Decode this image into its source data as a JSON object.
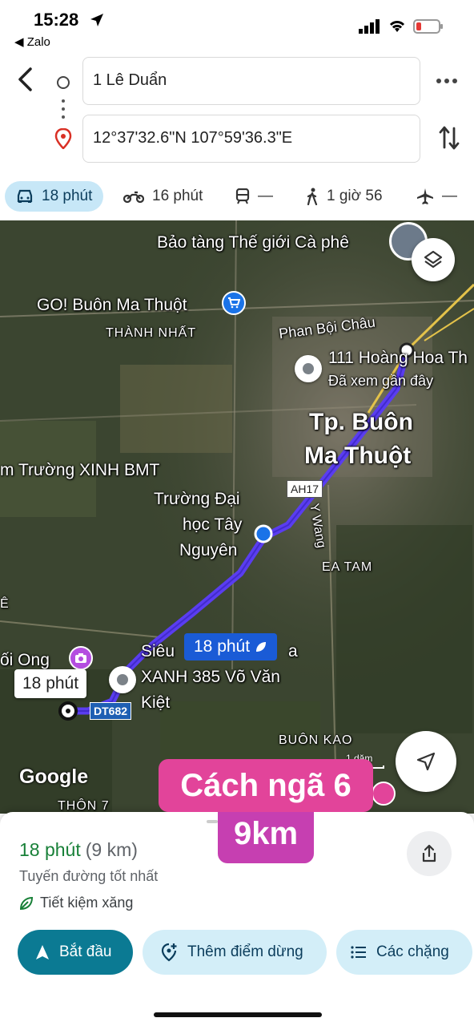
{
  "status_bar": {
    "time": "15:28",
    "back_app": "◀ Zalo"
  },
  "route": {
    "from": "1 Lê Duẩn",
    "to": "12°37'32.6\"N 107°59'36.3\"E"
  },
  "travel_modes": [
    {
      "name": "car",
      "label": "18 phút",
      "active": true
    },
    {
      "name": "motorbike",
      "label": "16 phút"
    },
    {
      "name": "transit",
      "label": "—"
    },
    {
      "name": "walk",
      "label": "1 giờ 56"
    },
    {
      "name": "flight",
      "label": "—"
    }
  ],
  "map": {
    "labels": {
      "museum": "Bảo tàng Thế giới Cà phê",
      "go_mall": "GO! Buôn Ma Thuột",
      "thanh_nhat": "THÀNH NHẤT",
      "phan_boi_chau": "Phan Bội Châu",
      "hoang_hoa": "111 Hoàng Hoa Th",
      "recently_viewed": "Đã xem gần đây",
      "city_line1": "Tp. Buôn",
      "city_line2": "Ma Thuột",
      "school": "m Trường XINH BMT",
      "university_1": "Trường Đại",
      "university_2": "học Tây",
      "university_3": "Nguyên",
      "y_wang": "Y Wang",
      "ea_tam": "EA TAM",
      "e_label": "Ê",
      "oi_ong": "ối Ong",
      "sieu_1": "Siêu",
      "sieu_1b": "a",
      "sieu_2": "XANH 385 Võ Văn",
      "sieu_3": "Kiệt",
      "buon_kao": "BUÔN KAO",
      "thon_7": "THÔN 7",
      "scale": "1 dặm",
      "google": "Google"
    },
    "route_chip": "18 phút",
    "dest_chip": "18 phút",
    "shield_ah17": "AH17",
    "shield_dt682": "DT682"
  },
  "banner": {
    "line1": "Cách ngã 6",
    "line2": "9km"
  },
  "sheet": {
    "eta": "18 phút",
    "distance": "(9 km)",
    "description": "Tuyến đường tốt nhất",
    "eco": "Tiết kiệm xăng",
    "start": "Bắt đầu",
    "add_stop": "Thêm điểm dừng",
    "steps": "Các chặng"
  },
  "colors": {
    "route": "#5a3df0",
    "accent": "#0b7a93",
    "eta": "#188038",
    "banner": "#e2449a"
  }
}
